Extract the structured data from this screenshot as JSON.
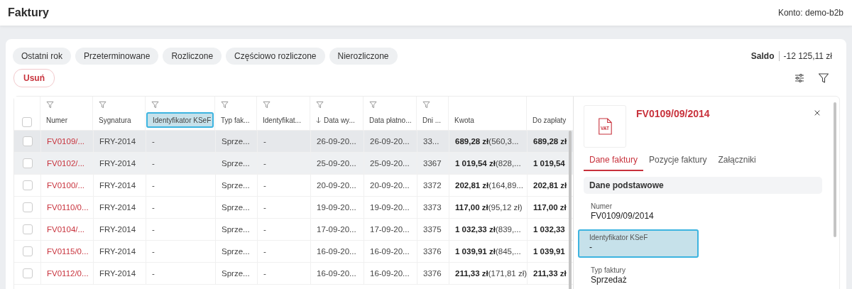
{
  "header": {
    "title": "Faktury",
    "account": "Konto: demo-b2b"
  },
  "filters": [
    {
      "label": "Ostatni rok",
      "selected": false
    },
    {
      "label": "Przeterminowane",
      "selected": false
    },
    {
      "label": "Rozliczone",
      "selected": false
    },
    {
      "label": "Częściowo rozliczone",
      "selected": false
    },
    {
      "label": "Nierozliczone",
      "selected": false
    }
  ],
  "balance": {
    "label": "Saldo",
    "value": "-12 125,11 zł"
  },
  "delete_button": "Usuń",
  "table": {
    "all_checked": false,
    "columns": [
      {
        "label": "Numer",
        "filter": true,
        "sorted": false,
        "highlighted": false
      },
      {
        "label": "Sygnatura",
        "filter": true,
        "sorted": false,
        "highlighted": false
      },
      {
        "label": "Identyfikator KSeF",
        "filter": true,
        "sorted": false,
        "highlighted": true
      },
      {
        "label": "Typ fak...",
        "filter": true,
        "sorted": false,
        "highlighted": false
      },
      {
        "label": "Identyfikat...",
        "filter": true,
        "sorted": false,
        "highlighted": false
      },
      {
        "label": "Data wy...",
        "filter": true,
        "sorted": true,
        "highlighted": false
      },
      {
        "label": "Data płatno...",
        "filter": true,
        "sorted": false,
        "highlighted": false
      },
      {
        "label": "Dni ...",
        "filter": true,
        "sorted": false,
        "highlighted": false
      },
      {
        "label": "Kwota",
        "filter": false,
        "sorted": false,
        "highlighted": false
      },
      {
        "label": "Do zapłaty",
        "filter": false,
        "sorted": false,
        "highlighted": false
      }
    ],
    "rows": [
      {
        "selected": true,
        "hovered": false,
        "checked": false,
        "cells": [
          "FV0109/...",
          "FRY-2014",
          "-",
          "Sprze...",
          "-",
          "26-09-20...",
          "26-09-20...",
          "33...",
          "**689,28 zł**(560,3...",
          "689,28 zł"
        ]
      },
      {
        "selected": false,
        "hovered": true,
        "checked": false,
        "cells": [
          "FV0102/...",
          "FRY-2014",
          "-",
          "Sprze...",
          "-",
          "25-09-20...",
          "25-09-20...",
          "3367",
          "**1 019,54 zł**(828,...",
          "1 019,54"
        ]
      },
      {
        "selected": false,
        "hovered": false,
        "checked": false,
        "cells": [
          "FV0100/...",
          "FRY-2014",
          "-",
          "Sprze...",
          "-",
          "20-09-20...",
          "20-09-20...",
          "3372",
          "**202,81 zł**(164,89...",
          "202,81 zł"
        ]
      },
      {
        "selected": false,
        "hovered": false,
        "checked": false,
        "cells": [
          "FV0110/0...",
          "FRY-2014",
          "-",
          "Sprze...",
          "-",
          "19-09-20...",
          "19-09-20...",
          "3373",
          "**117,00 zł**(95,12 zł)",
          "117,00 zł"
        ]
      },
      {
        "selected": false,
        "hovered": false,
        "checked": false,
        "cells": [
          "FV0104/...",
          "FRY-2014",
          "-",
          "Sprze...",
          "-",
          "17-09-20...",
          "17-09-20...",
          "3375",
          "**1 032,33 zł**(839,...",
          "1 032,33"
        ]
      },
      {
        "selected": false,
        "hovered": false,
        "checked": false,
        "cells": [
          "FV0115/0...",
          "FRY-2014",
          "-",
          "Sprze...",
          "-",
          "16-09-20...",
          "16-09-20...",
          "3376",
          "**1 039,91 zł**(845,...",
          "1 039,91"
        ]
      },
      {
        "selected": false,
        "hovered": false,
        "checked": false,
        "cells": [
          "FV0112/0...",
          "FRY-2014",
          "-",
          "Sprze...",
          "-",
          "16-09-20...",
          "16-09-20...",
          "3376",
          "**211,33 zł**(171,81 zł)",
          "211,33 zł"
        ]
      }
    ]
  },
  "detail": {
    "icon_text": "VAT",
    "title": "FV0109/09/2014",
    "tabs": [
      {
        "label": "Dane faktury",
        "selected": true
      },
      {
        "label": "Pozycje faktury",
        "selected": false
      },
      {
        "label": "Załączniki",
        "selected": false
      }
    ],
    "section": "Dane podstawowe",
    "fields": [
      {
        "label": "Numer",
        "value": "FV0109/09/2014",
        "highlighted": false
      },
      {
        "label": "Identyfikator KSeF",
        "value": "-",
        "highlighted": true
      },
      {
        "label": "Typ faktury",
        "value": "Sprzedaż",
        "highlighted": false
      }
    ]
  }
}
